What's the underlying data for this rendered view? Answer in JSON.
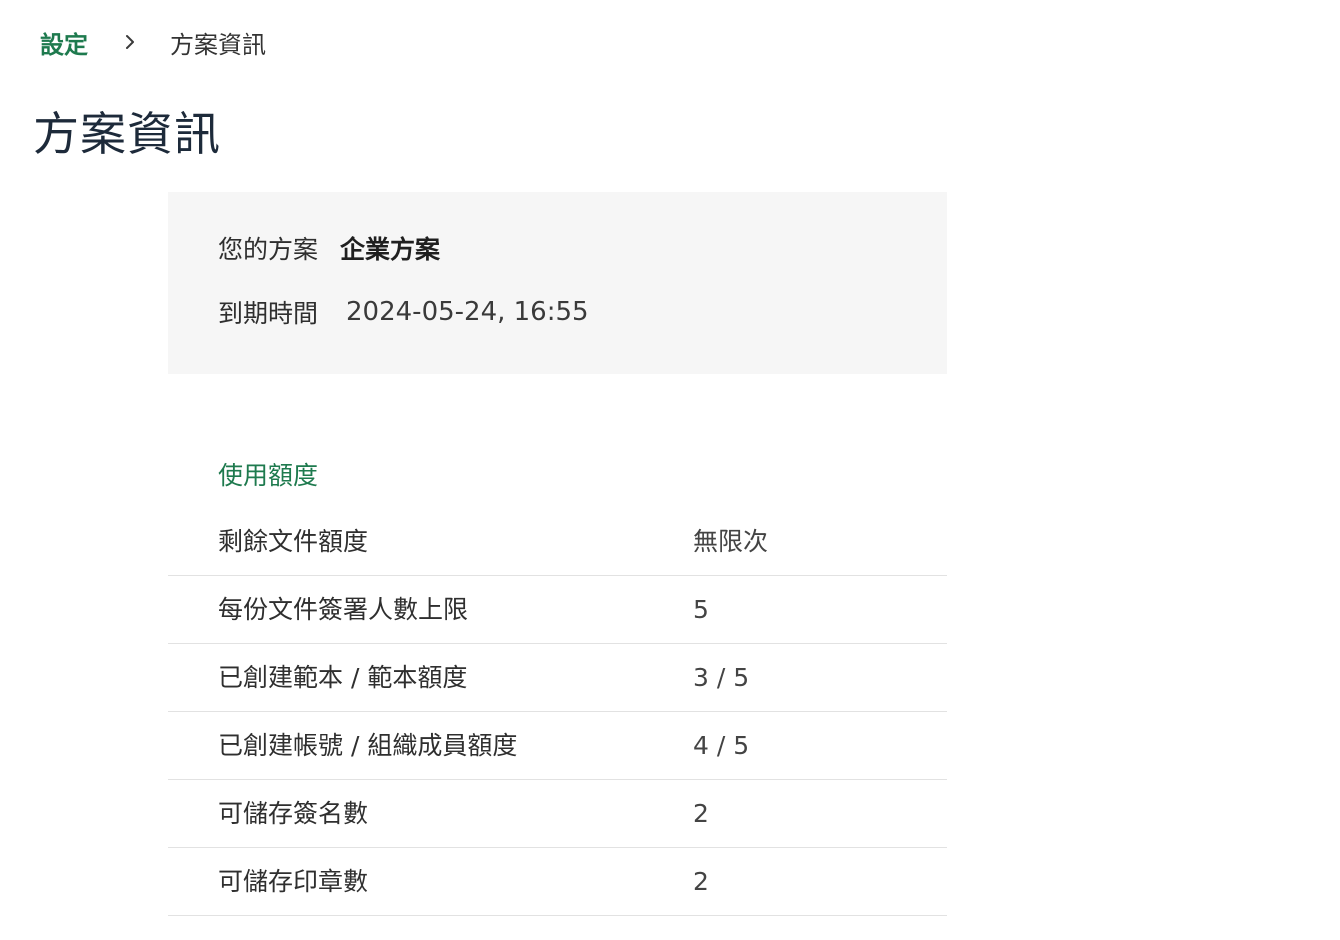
{
  "breadcrumb": {
    "parent": "設定",
    "current": "方案資訊"
  },
  "page": {
    "title": "方案資訊"
  },
  "plan": {
    "plan_label": "您的方案",
    "plan_value": "企業方案",
    "expiry_label": "到期時間",
    "expiry_value": "2024-05-24, 16:55"
  },
  "usage": {
    "title": "使用額度",
    "rows": [
      {
        "label": "剩餘文件額度",
        "value": "無限次"
      },
      {
        "label": "每份文件簽署人數上限",
        "value": "5"
      },
      {
        "label": "已創建範本 / 範本額度",
        "value": "3 / 5"
      },
      {
        "label": "已創建帳號 / 組織成員額度",
        "value": "4 / 5"
      },
      {
        "label": "可儲存簽名數",
        "value": "2"
      },
      {
        "label": "可儲存印章數",
        "value": "2"
      }
    ]
  },
  "colors": {
    "accent": "#1e7a4e",
    "card_bg": "#f6f6f6",
    "divider": "#e2e2e2",
    "title": "#1d2a3a"
  },
  "icons": {
    "breadcrumb_separator": "chevron-right-icon"
  }
}
